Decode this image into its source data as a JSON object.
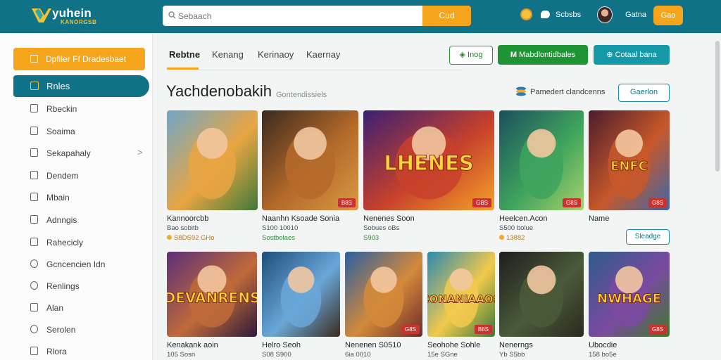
{
  "header": {
    "brand": "yuhein",
    "brand_sub": "KANORGSB",
    "search_placeholder": "Sebaach",
    "search_button": "Cud",
    "status_text": "Scbsbs",
    "user_name": "Gatna",
    "login_button": "Gao"
  },
  "sidebar": {
    "cta_label": "Dpfiler Ff Dradesbaet",
    "active_label": "Rnles",
    "items": [
      {
        "label": "Rbeckin",
        "icon": "doc-icon"
      },
      {
        "label": "Soaima",
        "icon": "user-icon"
      },
      {
        "label": "Sekapahaly",
        "icon": "lock-icon",
        "chevron": ">"
      },
      {
        "label": "Dendem",
        "icon": "tag-icon"
      },
      {
        "label": "Mbain",
        "icon": "home-icon"
      },
      {
        "label": "Adnngis",
        "icon": "building-icon"
      },
      {
        "label": "Rahecicly",
        "icon": "clipboard-icon"
      },
      {
        "label": "Gcncencien Idn",
        "icon": "refresh-icon"
      },
      {
        "label": "Renlings",
        "icon": "info-icon"
      },
      {
        "label": "Alan",
        "icon": "monitor-icon"
      },
      {
        "label": "Serolen",
        "icon": "clock-icon"
      },
      {
        "label": "Rlora",
        "icon": "trash-icon"
      }
    ]
  },
  "tabs": [
    "Rebtne",
    "Kenang",
    "Kerinaoy",
    "Kaernay"
  ],
  "toolbar": {
    "outline_button": "Inog",
    "green_button": "Mabdlontidbales",
    "teal_button": "Cotaal bana"
  },
  "title": "Yachdenobakih",
  "subtitle": "Gontendissiels",
  "sort_label": "Pamedert clandcenns",
  "filter_button": "Gaerlon",
  "card_button": "Sleadge",
  "games": [
    {
      "name": "Kannoorcbb",
      "meta1": "Bao sobitb",
      "meta2": "S8DS92 GHo",
      "badge": "",
      "meta2_style": "gold"
    },
    {
      "name": "Naanhn Ksoade Sonia",
      "meta1": "S100 10010",
      "meta2": "Sostbolaes",
      "badge": "B8S",
      "meta2_style": "green"
    },
    {
      "name": "Nenenes Soon",
      "meta1": "Sobues oBs",
      "meta2": "S903",
      "badge": "GBS",
      "meta2_style": "green"
    },
    {
      "name": "Heelcen.Acon",
      "meta1": "S500 bolue",
      "meta2": "13882",
      "badge": "G8S",
      "meta2_style": "gold"
    },
    {
      "name": "Name",
      "meta1": "",
      "meta2": "",
      "badge": "G8S",
      "meta2_style": ""
    },
    {
      "name": "Kenakank aoin",
      "meta1": "105 Sosn",
      "meta2": "",
      "badge": "",
      "meta2_style": ""
    },
    {
      "name": "Helro Seoh",
      "meta1": "S08 S900",
      "meta2": "",
      "badge": "",
      "meta2_style": ""
    },
    {
      "name": "Nenenen S0510",
      "meta1": "6ia 0010",
      "meta2": "",
      "badge": "G8S",
      "meta2_style": ""
    },
    {
      "name": "Seohohe Sohle",
      "meta1": "15e SGne",
      "meta2": "",
      "badge": "B8S",
      "meta2_style": ""
    },
    {
      "name": "Nenerngs",
      "meta1": "Yb S5bb",
      "meta2": "",
      "badge": "",
      "meta2_style": ""
    },
    {
      "name": "Ubocdie",
      "meta1": "158 bo5e",
      "meta2": "",
      "badge": "G8S",
      "meta2_style": ""
    }
  ],
  "art_text": {
    "card3": "LHENES",
    "card5": "ENFC",
    "card6": "DEVANRENS",
    "card9": "CONANIAAOS",
    "card11": "NWHAGE"
  },
  "colors": {
    "header": "#0f7287",
    "accent_orange": "#f5a51c",
    "green": "#1f9434",
    "teal": "#1598a8",
    "badge_red": "#c9332f"
  }
}
